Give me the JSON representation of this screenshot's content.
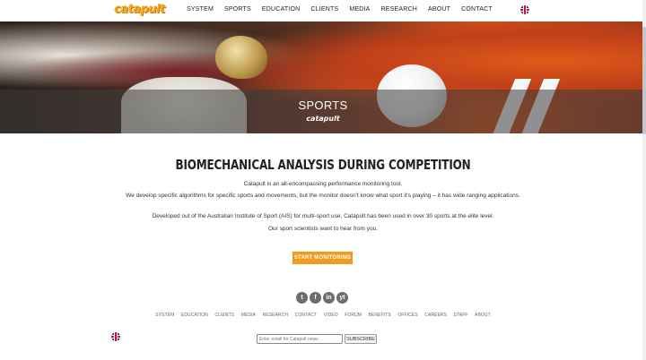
{
  "header": {
    "logo_text": "catapult",
    "nav": [
      "SYSTEM",
      "SPORTS",
      "EDUCATION",
      "CLIENTS",
      "MEDIA",
      "RESEARCH",
      "ABOUT",
      "CONTACT"
    ],
    "language_icon": "uk-flag-icon"
  },
  "hero": {
    "title": "SPORTS",
    "logo_text": "catapult"
  },
  "main": {
    "headline": "BIOMECHANICAL ANALYSIS DURING COMPETITION",
    "p1": "Catapult is an all-encompassing performance monitoring tool.",
    "p2": "We develop specific algorithms for specific sports and movements, but the monitor doesn't know what sport it's playing – it has wide ranging applications.",
    "p3": "Developed out of the Australian Institute of Sport (AIS) for multi-sport use, Catapult has been used in over 30 sports at the elite level.",
    "p4": "Our sport scientists want to hear from you.",
    "cta_label": "START MONITORING"
  },
  "social": {
    "twitter": "t",
    "facebook": "f",
    "linkedin": "in",
    "youtube": "yt"
  },
  "footer_nav": [
    "SYSTEM",
    "EDUCATION",
    "CLIENTS",
    "MEDIA",
    "RESEARCH",
    "CONTACT",
    "VIDEO",
    "FORUM",
    "BENEFITS",
    "OFFICES",
    "CAREERS",
    "STAFF",
    "ABOUT"
  ],
  "newsletter": {
    "placeholder": "Enter email for Catapult news",
    "subscribe_label": "SUBSCRIBE"
  },
  "colors": {
    "accent": "#f29a1f"
  }
}
